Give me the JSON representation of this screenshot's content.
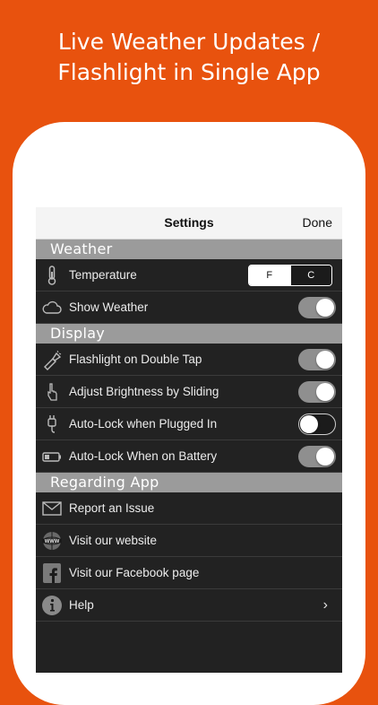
{
  "headline": {
    "line1": "Live Weather Updates /",
    "line2": "Flashlight in Single App"
  },
  "navbar": {
    "title": "Settings",
    "done": "Done"
  },
  "sections": {
    "weather": "Weather",
    "display": "Display",
    "regarding": "Regarding App"
  },
  "weather": {
    "temperature": {
      "label": "Temperature",
      "option_f": "F",
      "option_c": "C",
      "selected": "F"
    },
    "show_weather": {
      "label": "Show Weather",
      "on": true
    }
  },
  "display": {
    "flashlight": {
      "label": "Flashlight on Double Tap",
      "on": true
    },
    "brightness": {
      "label": "Adjust Brightness by Sliding",
      "on": true
    },
    "autolock_plugged": {
      "label": "Auto-Lock when Plugged In",
      "on": false
    },
    "autolock_battery": {
      "label": "Auto-Lock When on Battery",
      "on": true
    }
  },
  "regarding": {
    "report": {
      "label": "Report an Issue"
    },
    "website": {
      "label": "Visit our website"
    },
    "facebook": {
      "label": "Visit our Facebook page"
    },
    "help": {
      "label": "Help"
    }
  },
  "icons": {
    "temperature": "thermometer-icon",
    "show_weather": "cloud-icon",
    "flashlight": "flashlight-icon",
    "brightness": "hand-pointer-icon",
    "autolock_plugged": "plug-icon",
    "autolock_battery": "battery-icon",
    "report": "envelope-icon",
    "website": "globe-www-icon",
    "facebook": "facebook-icon",
    "help": "info-icon",
    "help_chevron": "chevron-right-icon"
  },
  "colors": {
    "background": "#e8520e",
    "section": "#9b9b9b",
    "row": "#222222",
    "toggle_on": "#8f8f8f"
  }
}
